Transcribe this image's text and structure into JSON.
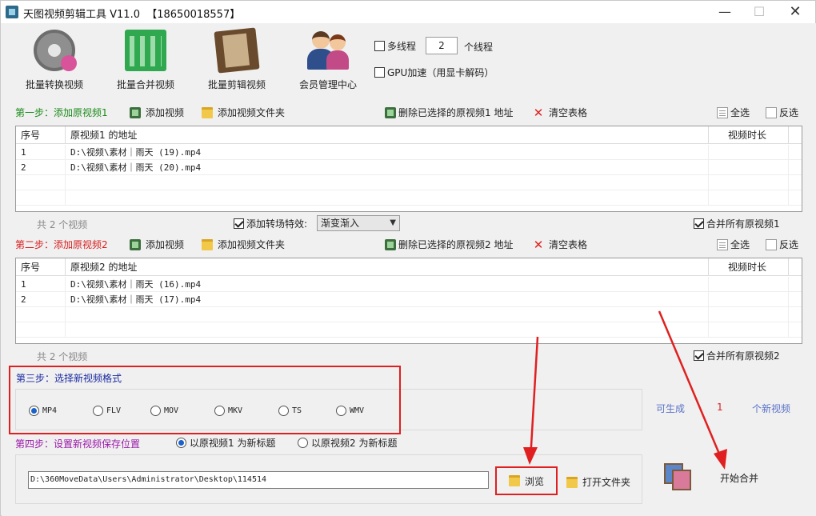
{
  "window": {
    "title": "天图视频剪辑工具 V11.0  【18650018557】",
    "controls": {
      "minimize": "—",
      "maximize": "☐",
      "close": "✕"
    }
  },
  "toolbar": [
    {
      "label": "批量转换视频",
      "icon": "film-reel-icon"
    },
    {
      "label": "批量合并视频",
      "icon": "merge-grid-icon"
    },
    {
      "label": "批量剪辑视频",
      "icon": "film-strip-icon"
    },
    {
      "label": "会员管理中心",
      "icon": "users-icon"
    }
  ],
  "options": {
    "multithread_label": "多线程",
    "thread_count": "2",
    "thread_unit": "个线程",
    "gpu_label": "GPU加速（用显卡解码）"
  },
  "step1": {
    "title": "第一步：添加原视频1",
    "add_video": "添加视频",
    "add_folder": "添加视频文件夹",
    "delete_selected": "删除已选择的原视频1 地址",
    "clear_table": "清空表格",
    "select_all": "全选",
    "invert": "反选",
    "table": {
      "headers": [
        "序号",
        "原视频1 的地址",
        "视频时长"
      ],
      "rows": [
        {
          "index": "1",
          "path": "D:\\视频\\素材｜雨天 (19).mp4",
          "duration": ""
        },
        {
          "index": "2",
          "path": "D:\\视频\\素材｜雨天 (20).mp4",
          "duration": ""
        }
      ]
    },
    "count_text": "共 2 个视频",
    "transition_label": "添加转场特效:",
    "transition_value": "渐变渐入",
    "merge_all": "合并所有原视频1"
  },
  "step2": {
    "title": "第二步：添加原视频2",
    "add_video": "添加视频",
    "add_folder": "添加视频文件夹",
    "delete_selected": "删除已选择的原视频2 地址",
    "clear_table": "清空表格",
    "select_all": "全选",
    "invert": "反选",
    "table": {
      "headers": [
        "序号",
        "原视频2 的地址",
        "视频时长"
      ],
      "rows": [
        {
          "index": "1",
          "path": "D:\\视频\\素材｜雨天 (16).mp4",
          "duration": ""
        },
        {
          "index": "2",
          "path": "D:\\视频\\素材｜雨天 (17).mp4",
          "duration": ""
        }
      ]
    },
    "count_text": "共 2 个视频",
    "merge_all": "合并所有原视频2"
  },
  "step3": {
    "title": "第三步：选择新视频格式",
    "formats": [
      "MP4",
      "FLV",
      "MOV",
      "MKV",
      "TS",
      "WMV"
    ],
    "selected": "MP4",
    "can_generate": "可生成",
    "generate_count": "1",
    "new_videos": "个新视频"
  },
  "step4": {
    "title": "第四步：设置新视频保存位置",
    "title_option_1": "以原视频1 为新标题",
    "title_option_2": "以原视频2 为新标题",
    "selected_option": "以原视频1 为新标题",
    "save_path": "D:\\360MoveData\\Users\\Administrator\\Desktop\\114514",
    "browse": "浏览",
    "open_folder": "打开文件夹",
    "start_merge": "开始合并"
  },
  "colors": {
    "step1": "#1a8a1a",
    "step2": "#d81e1e",
    "step3": "#1a2aa0",
    "step4": "#9a1aa8",
    "annotation": "#e02020"
  }
}
